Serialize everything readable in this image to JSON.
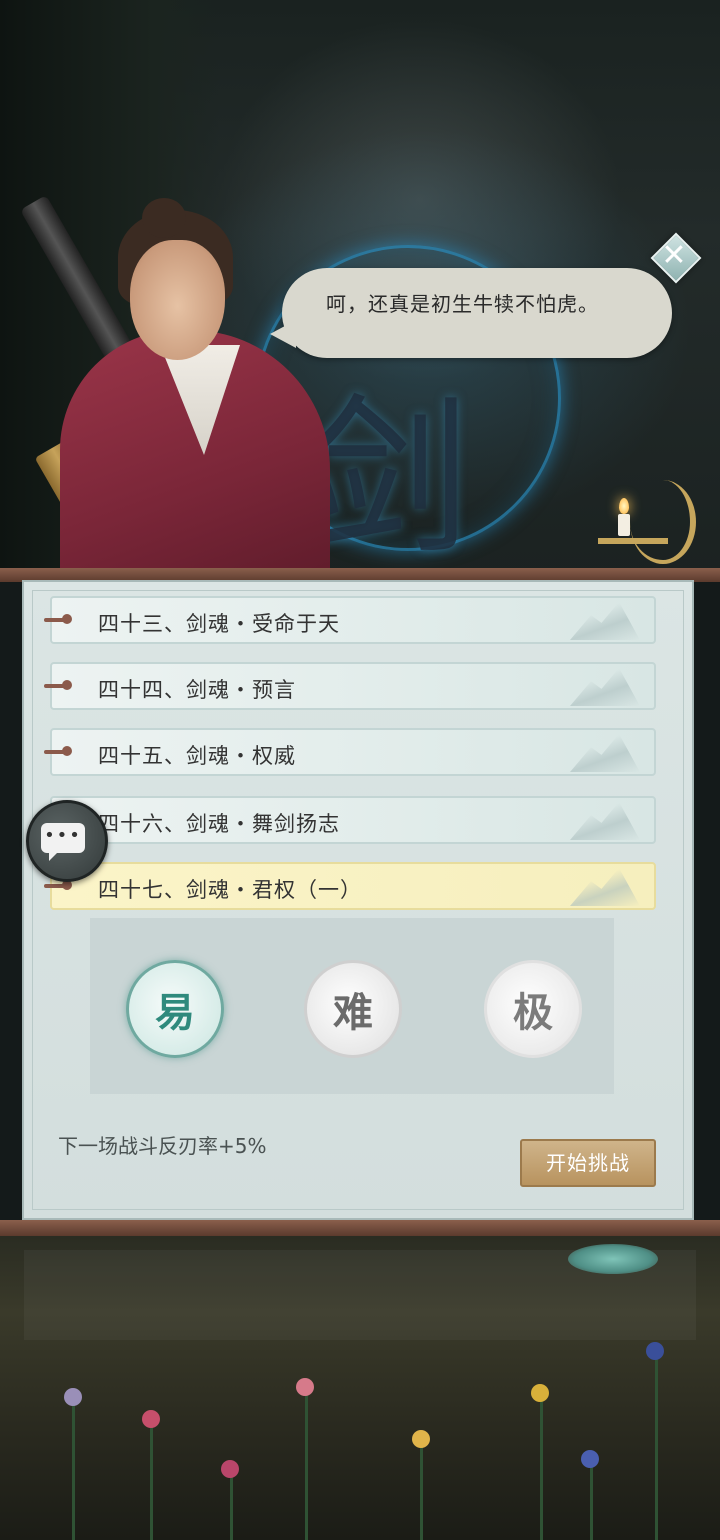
{
  "dialogue": {
    "text": "呵，还真是初生牛犊不怕虎。"
  },
  "background": {
    "glyph": "剑"
  },
  "levels": [
    {
      "label": "四十三、剑魂・受命于天",
      "selected": false
    },
    {
      "label": "四十四、剑魂・预言",
      "selected": false
    },
    {
      "label": "四十五、剑魂・权威",
      "selected": false
    },
    {
      "label": "四十六、剑魂・舞剑扬志",
      "selected": false
    },
    {
      "label": "四十七、剑魂・君权（一）",
      "selected": true
    }
  ],
  "difficulty": {
    "easy": "易",
    "hard": "难",
    "extreme": "极",
    "selected": "easy"
  },
  "bonus_text": "下一场战斗反刃率+5%",
  "start_button": "开始挑战",
  "colors": {
    "selected_level_bg": "#fbf4c8",
    "start_button": "#c3a16e",
    "easy_accent": "#2f8a7d"
  },
  "icons": {
    "close": "close-icon",
    "chat": "chat-icon",
    "candle": "candle-icon"
  }
}
